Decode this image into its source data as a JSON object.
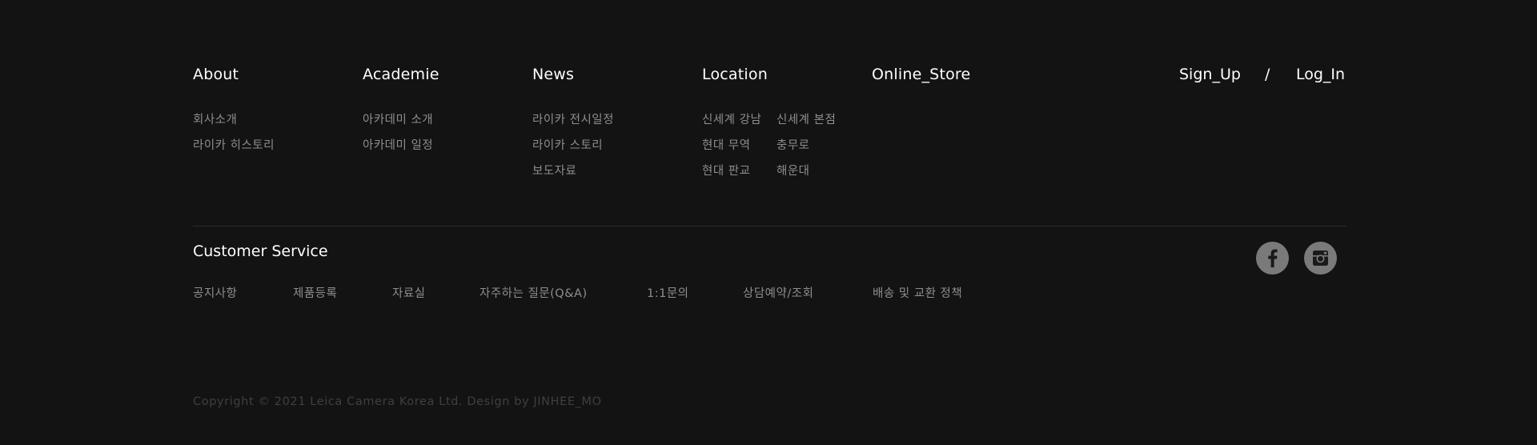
{
  "nav": {
    "about": {
      "title": "About",
      "items": [
        "회사소개",
        "라이카 히스토리"
      ]
    },
    "academie": {
      "title": "Academie",
      "items": [
        "아카데미 소개",
        "아카데미 일정"
      ]
    },
    "news": {
      "title": "News",
      "items": [
        "라이카 전시일정",
        "라이카 스토리",
        "보도자료"
      ]
    },
    "location": {
      "title": "Location",
      "col1": [
        "신세계 강남",
        "현대 무역",
        "현대 판교"
      ],
      "col2": [
        "신세계 본점",
        "충무로",
        "해운대"
      ]
    },
    "online_store": {
      "title": "Online_Store"
    }
  },
  "auth": {
    "sign_up": "Sign_Up",
    "separator": "/",
    "log_in": "Log_In"
  },
  "customer_service": {
    "title": "Customer Service",
    "links": [
      "공지사항",
      "제품등록",
      "자료실",
      "자주하는 질문(Q&A)",
      "1:1문의",
      "상담예약/조회",
      "배송 및 교환 정책"
    ]
  },
  "social": {
    "facebook_icon": "facebook-icon",
    "instagram_icon": "instagram-icon"
  },
  "copyright": "Copyright © 2021 Leica Camera Korea Ltd. Design by JINHEE_MO",
  "colors": {
    "background": "#131313",
    "heading": "#ffffff",
    "link": "#8e8e8e",
    "divider": "#2c2c2c",
    "social_bg": "#7a7a7a",
    "copyright": "#3f3f3f"
  }
}
